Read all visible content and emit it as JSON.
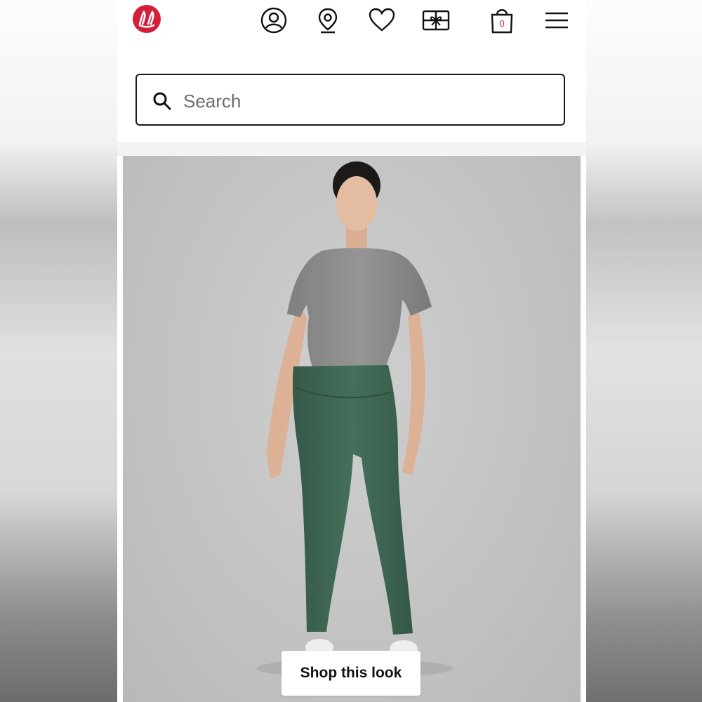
{
  "header": {
    "logo_icon": "lululemon-logo-icon",
    "icons": [
      "account-icon",
      "store-locator-icon",
      "wishlist-heart-icon",
      "gift-card-icon",
      "shopping-bag-icon",
      "hamburger-menu-icon"
    ],
    "bag_count": "0"
  },
  "search": {
    "placeholder": "Search",
    "value": ""
  },
  "hero": {
    "cta_label": "Shop this look"
  },
  "colors": {
    "brand_red": "#d31f38",
    "legging_green": "#3f6552",
    "shirt_gray": "#8e8e8e",
    "background_gray": "#c6c6c6"
  }
}
